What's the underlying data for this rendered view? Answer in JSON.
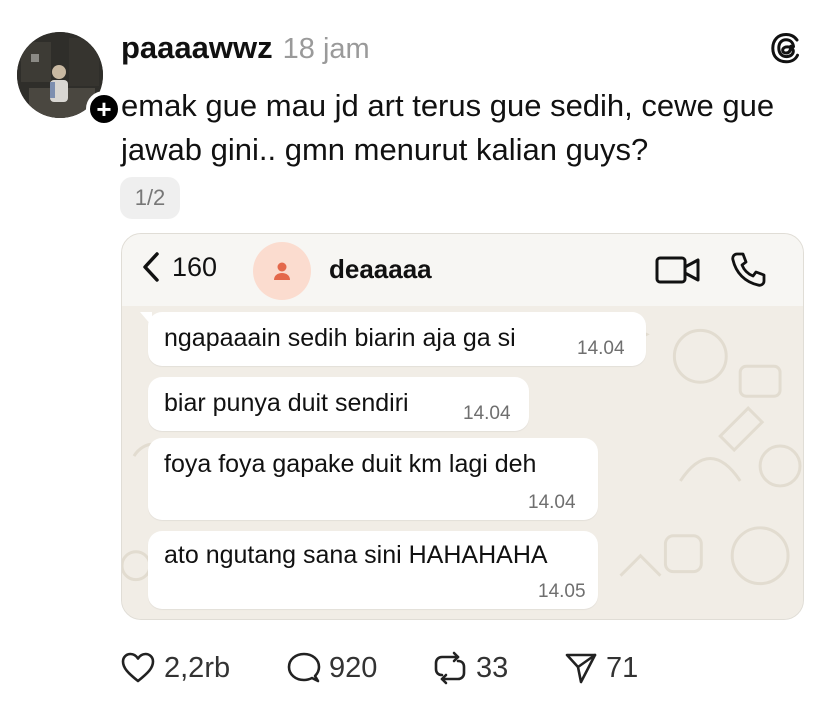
{
  "post": {
    "username": "paaaawwz",
    "timestamp": "18 jam",
    "follow_symbol": "+",
    "text": "emak gue mau jd art terus gue sedih, cewe gue jawab gini.. gmn menurut kalian guys?",
    "page_indicator": "1/2"
  },
  "chat": {
    "back_count": "160",
    "contact_name": "deaaaaa",
    "messages": [
      {
        "text": "ngapaaain sedih biarin aja ga si",
        "time": "14.04"
      },
      {
        "text": "biar punya duit sendiri",
        "time": "14.04"
      },
      {
        "text": "foya foya gapake duit km lagi deh",
        "time": "14.04"
      },
      {
        "text": "ato ngutang sana sini HAHAHAHA",
        "time": "14.05"
      }
    ]
  },
  "actions": {
    "likes": "2,2rb",
    "replies": "920",
    "reposts": "33",
    "shares": "71"
  },
  "icons": {
    "like": "heart-icon",
    "reply": "comment-bubble-icon",
    "repost": "repost-icon",
    "share": "send-icon",
    "logo": "threads-logo-icon"
  },
  "colors": {
    "contact_avatar_bg": "#fbdccf",
    "contact_avatar_fg": "#e4684b",
    "chat_background": "#f1ede6"
  }
}
